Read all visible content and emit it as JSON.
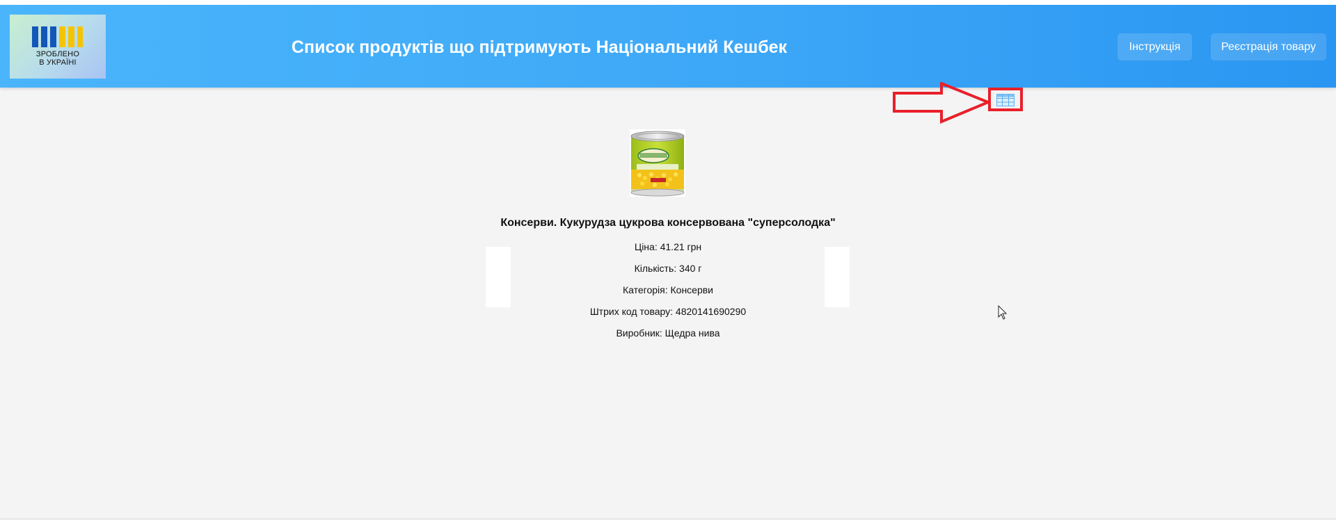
{
  "header": {
    "logo_text": "ЗРОБЛЕНО\nВ УКРАЇНІ",
    "title": "Список продуктів що підтримують Національний Кешбек",
    "buttons": {
      "instruction": "Інструкція",
      "register": "Реєстрація товару"
    }
  },
  "icons": {
    "view_toggle": "table-grid-icon",
    "annotation": "red-arrow-icon",
    "cursor": "mouse-pointer-icon"
  },
  "product": {
    "title": "Консерви. Кукурудза цукрова консервована \"суперсолодка\"",
    "price": "Ціна: 41.21 грн",
    "quantity": "Кількість: 340 г",
    "category": "Категорія: Консерви",
    "barcode": "Штрих код товару: 4820141690290",
    "manufacturer": "Виробник: Щедра нива"
  },
  "colors": {
    "header_start": "#4ab5fb",
    "header_end": "#2a96f1",
    "annotation_red": "#e8202a",
    "logo_blue": "#1457b8",
    "logo_yellow": "#f5c400"
  }
}
